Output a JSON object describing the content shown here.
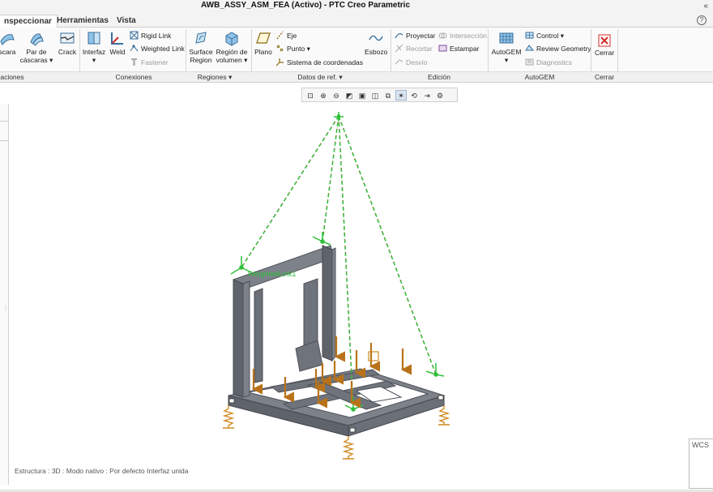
{
  "window": {
    "title": "AWB_ASSY_ASM_FEA (Activo) - PTC Creo Parametric",
    "controls_glyph": "«"
  },
  "tabs": [
    {
      "label": "nspeccionar"
    },
    {
      "label": "Herramientas"
    },
    {
      "label": "Vista"
    }
  ],
  "help_glyph": "?",
  "ribbon": {
    "buttons": {
      "cascara": "scara",
      "par_cascaras_1": "Par de",
      "par_cascaras_2": "cáscaras",
      "crack": "Crack",
      "interfaz": "Interfaz",
      "weld": "Weld",
      "rigid_link": "Rigid Link",
      "weighted_link": "Weighted Link",
      "fastener": "Fastener",
      "surface_region_1": "Surface",
      "surface_region_2": "Region",
      "region_volumen_1": "Región de",
      "region_volumen_2": "volumen",
      "plano": "Plano",
      "eje": "Eje",
      "punto": "Punto",
      "sistema_coord": "Sistema de coordenadas",
      "esbozo": "Esbozo",
      "proyectar": "Proyectar",
      "interseccion": "Intersección",
      "recortar": "Recortar",
      "estampar": "Estampar",
      "desvio": "Desvío",
      "autogem": "AutoGEM",
      "control": "Control",
      "review_geometry": "Review Geometry",
      "diagnostics": "Diagnostics",
      "cerrar": "Cerrar"
    },
    "groups": {
      "idealizaciones": "aciones",
      "conexiones": "Conexiones",
      "regiones": "Regiones",
      "datos_ref": "Datos de ref.",
      "edicion": "Edición",
      "autogem": "AutoGEM",
      "cerrar": "Cerrar"
    }
  },
  "view_toolbar": {
    "buttons": [
      "zoom-fit",
      "zoom-in",
      "zoom-out",
      "repaint",
      "saved-views",
      "display-style",
      "perspective",
      "datum-display",
      "spin-center",
      "simulation-display",
      "annotation-display"
    ],
    "active": [
      "datum-display"
    ]
  },
  "model": {
    "weighted_link_label": "WeightedLink1"
  },
  "status_bar": {
    "text": "Estructura : 3D : Modo nativo : Por defecto Interfaz unida",
    "wcs_label": "WCS"
  },
  "colors": {
    "accent_green": "#2fbf3a",
    "steel": "#6f737b",
    "load_arrow": "#b8731a",
    "spring": "#d08a20",
    "close_red": "#d42a2a"
  }
}
